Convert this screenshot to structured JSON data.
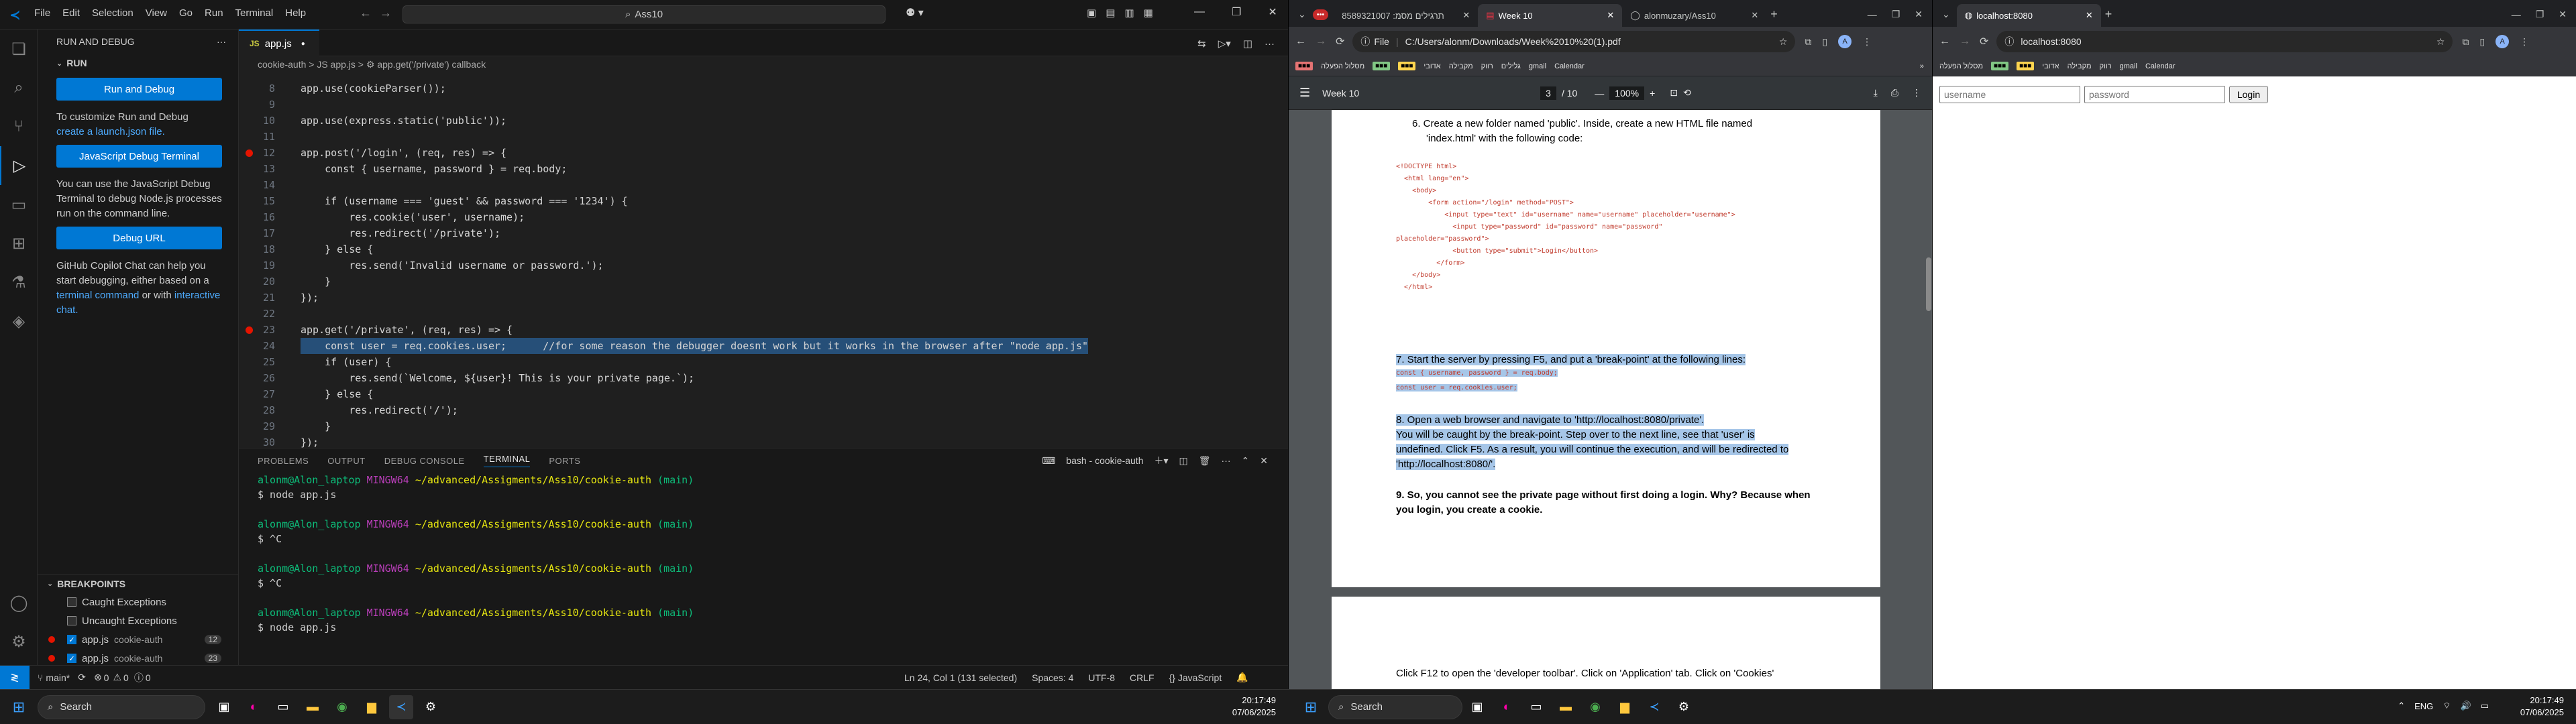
{
  "vscode": {
    "menu": [
      "File",
      "Edit",
      "Selection",
      "View",
      "Go",
      "Run",
      "Terminal",
      "Help"
    ],
    "command_center": "Ass10",
    "sidebar": {
      "title": "RUN AND DEBUG",
      "section": "RUN",
      "run_button": "Run and Debug",
      "launch_text_1": "To customize Run and Debug",
      "launch_link": "create a launch.json file.",
      "terminal_button": "JavaScript Debug Terminal",
      "terminal_text": "You can use the JavaScript Debug Terminal to debug Node.js processes run on the command line.",
      "debug_url_button": "Debug URL",
      "copilot_text_1": "GitHub Copilot Chat can help you start debugging, either based on a",
      "copilot_link_1": "terminal command",
      "copilot_text_2": "or with",
      "copilot_link_2": "interactive chat."
    },
    "breakpoints": {
      "title": "BREAKPOINTS",
      "items": [
        {
          "label": "Caught Exceptions",
          "checked": false
        },
        {
          "label": "Uncaught Exceptions",
          "checked": false
        },
        {
          "label": "app.js",
          "sub": "cookie-auth",
          "count": "12",
          "checked": true
        },
        {
          "label": "app.js",
          "sub": "cookie-auth",
          "count": "23",
          "checked": true
        }
      ]
    },
    "tab": {
      "label": "app.js"
    },
    "breadcrumb": "cookie-auth  >  JS app.js  >  ⚙ app.get('/private') callback",
    "code_lines": [
      {
        "num": "",
        "text": ""
      },
      {
        "num": "8",
        "text": "app.use(cookieParser());"
      },
      {
        "num": "9",
        "text": ""
      },
      {
        "num": "10",
        "text": "app.use(express.static('public'));"
      },
      {
        "num": "11",
        "text": ""
      },
      {
        "num": "12",
        "text": "app.post('/login', (req, res) => {"
      },
      {
        "num": "13",
        "text": "    const { username, password } = req.body;"
      },
      {
        "num": "14",
        "text": ""
      },
      {
        "num": "15",
        "text": "    if (username === 'guest' && password === '1234') {"
      },
      {
        "num": "16",
        "text": "        res.cookie('user', username);"
      },
      {
        "num": "17",
        "text": "        res.redirect('/private');"
      },
      {
        "num": "18",
        "text": "    } else {"
      },
      {
        "num": "19",
        "text": "        res.send('Invalid username or password.');"
      },
      {
        "num": "20",
        "text": "    }"
      },
      {
        "num": "21",
        "text": "});"
      },
      {
        "num": "22",
        "text": ""
      },
      {
        "num": "23",
        "text": "app.get('/private', (req, res) => {"
      },
      {
        "num": "24",
        "text": "    const user = req.cookies.user;      //for some reason the debugger doesnt work but it works in the browser after \"node app.js\""
      },
      {
        "num": "25",
        "text": "    if (user) {"
      },
      {
        "num": "26",
        "text": "        res.send(`Welcome, ${user}! This is your private page.`);"
      },
      {
        "num": "27",
        "text": "    } else {"
      },
      {
        "num": "28",
        "text": "        res.redirect('/');"
      },
      {
        "num": "29",
        "text": "    }"
      },
      {
        "num": "30",
        "text": "});"
      }
    ],
    "panel_tabs": [
      "PROBLEMS",
      "OUTPUT",
      "DEBUG CONSOLE",
      "TERMINAL",
      "PORTS"
    ],
    "terminal_name": "bash - cookie-auth",
    "terminal_lines": [
      {
        "user": "alonm@Alon_laptop",
        "host": "MINGW64",
        "path": "~/advanced/Assigments/Ass10/cookie-auth",
        "branch": "(main)"
      },
      {
        "cmd": "$ node app.js"
      },
      {
        "blank": ""
      },
      {
        "user": "alonm@Alon_laptop",
        "host": "MINGW64",
        "path": "~/advanced/Assigments/Ass10/cookie-auth",
        "branch": "(main)"
      },
      {
        "cmd": "$ ^C"
      },
      {
        "blank": ""
      },
      {
        "user": "alonm@Alon_laptop",
        "host": "MINGW64",
        "path": "~/advanced/Assigments/Ass10/cookie-auth",
        "branch": "(main)"
      },
      {
        "cmd": "$ ^C"
      },
      {
        "blank": ""
      },
      {
        "user": "alonm@Alon_laptop",
        "host": "MINGW64",
        "path": "~/advanced/Assigments/Ass10/cookie-auth",
        "branch": "(main)"
      },
      {
        "cmd": "$ node app.js"
      }
    ],
    "status": {
      "branch": "main*",
      "errors": "0",
      "warnings": "0",
      "info": "0",
      "position": "Ln 24, Col 1 (131 selected)",
      "spaces": "Spaces: 4",
      "encoding": "UTF-8",
      "eol": "CRLF",
      "language": "{} JavaScript"
    }
  },
  "taskbar_left": {
    "search": "Search",
    "time": "20:17:49",
    "date": "07/06/2025"
  },
  "taskbar_right": {
    "search": "Search",
    "lang": "ENG",
    "time": "20:17:49",
    "date": "07/06/2025"
  },
  "chrome_pdf": {
    "tabs": [
      "8589321007 :תרגילים מסמ",
      "Week 10",
      "alonmuzary/Ass10"
    ],
    "address": "C:/Users/alonm/Downloads/Week%2010%20(1).pdf",
    "address_label": "File",
    "bookmarks": [
      "מסלול הפעלה",
      "אדובי",
      "מקבילה",
      "רווק",
      "גלילים",
      "gmail",
      "Calendar"
    ],
    "pdf_title": "Week 10",
    "page_current": "3",
    "page_total": "/ 10",
    "zoom": "100%",
    "step6_title": "6.   Create a new folder named 'public'. Inside, create a new HTML file named",
    "step6_title_2": "'index.html' with the following code:",
    "html_code": [
      "<!DOCTYPE html>",
      "  <html lang=\"en\">",
      "    <body>",
      "        <form action=\"/login\" method=\"POST\">",
      "            <input type=\"text\" id=\"username\" name=\"username\" placeholder=\"username\">",
      "              <input type=\"password\" id=\"password\" name=\"password\"",
      "placeholder=\"password\">",
      "              <button type=\"submit\">Login</button>",
      "          </form>",
      "    </body>",
      "  </html>"
    ],
    "step7": "7. Start the server by pressing F5, and put a 'break-point' at the following lines:",
    "step7_code_1": "const { username, password } = req.body;",
    "step7_code_2": "const user = req.cookies.user;",
    "step8_1": "8. Open a web browser and navigate to 'http://localhost:8080/private'.",
    "step8_2": "You will be caught by the break-point. Step over to the next line, see that 'user' is",
    "step8_3": "undefined. Click F5. As a result, you will continue the execution, and will be redirected to",
    "step8_4": "'http://localhost:8080/'.",
    "step9_1": "9. So, you cannot see the private page without first doing a login. Why? Because when",
    "step9_2": "you login, you create a cookie.",
    "next_page_text": "Click F12 to open the 'developer toolbar'. Click on 'Application' tab. Click on 'Cookies'"
  },
  "chrome_local": {
    "tab": "localhost:8080",
    "address": "localhost:8080",
    "username_placeholder": "username",
    "password_placeholder": "password",
    "login_label": "Login"
  }
}
